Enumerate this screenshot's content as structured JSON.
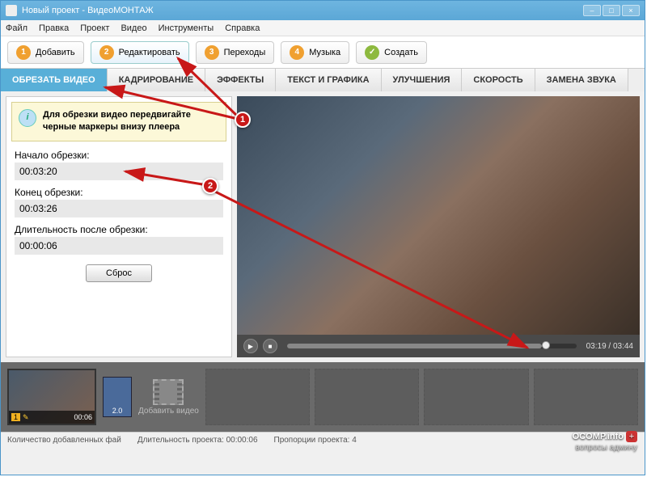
{
  "titlebar": {
    "text": "Новый проект - ВидеоМОНТАЖ"
  },
  "menu": {
    "file": "Файл",
    "edit": "Правка",
    "project": "Проект",
    "video": "Видео",
    "tools": "Инструменты",
    "help": "Справка"
  },
  "steps": {
    "s1": "Добавить",
    "s2": "Редактировать",
    "s3": "Переходы",
    "s4": "Музыка",
    "s5": "Создать"
  },
  "tabs": {
    "trim": "ОБРЕЗАТЬ ВИДЕО",
    "crop": "КАДРИРОВАНИЕ",
    "effects": "ЭФФЕКТЫ",
    "text": "ТЕКСТ И ГРАФИКА",
    "enhance": "УЛУЧШЕНИЯ",
    "speed": "СКОРОСТЬ",
    "audio": "ЗАМЕНА ЗВУКА"
  },
  "panel": {
    "hint": "Для обрезки видео передвигайте черные маркеры внизу плеера",
    "start_label": "Начало обрезки:",
    "start_value": "00:03:20",
    "end_label": "Конец обрезки:",
    "end_value": "00:03:26",
    "dur_label": "Длительность после обрезки:",
    "dur_value": "00:00:06",
    "reset": "Сброс"
  },
  "player": {
    "time": "03:19 / 03:44"
  },
  "timeline": {
    "clip_index": "1",
    "clip_duration": "00:06",
    "transition": "2.0",
    "add_video": "Добавить видео"
  },
  "status": {
    "files": "Количество добавленных фай",
    "duration": "Длительность проекта:  00:00:06",
    "proportions": "Пропорции проекта: 4"
  },
  "watermark": {
    "line1": "OCOMP.info",
    "line2": "вопросы админу"
  },
  "annotations": {
    "m1": "1",
    "m2": "2"
  }
}
